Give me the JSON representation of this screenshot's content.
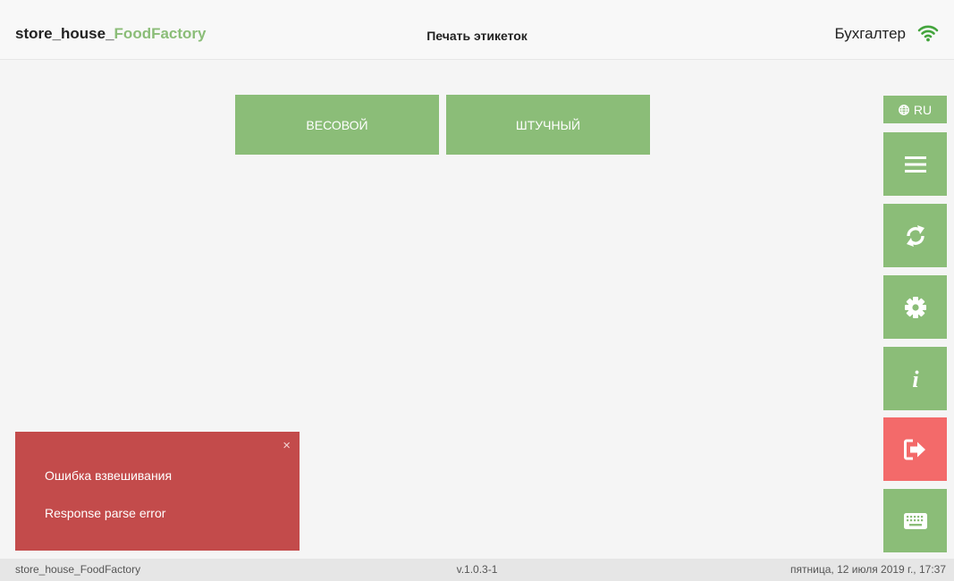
{
  "header": {
    "brand_prefix": "store_house_",
    "brand_accent": "FoodFactory",
    "title": "Печать этикеток",
    "user": "Бухгалтер",
    "connection_icon": "wifi-icon"
  },
  "modes": {
    "weight_label": "ВЕСОВОЙ",
    "piece_label": "ШТУЧНЫЙ"
  },
  "side_panel": {
    "language_label": "RU",
    "language_icon": "globe-icon",
    "buttons": [
      {
        "icon": "menu-icon"
      },
      {
        "icon": "sync-icon"
      },
      {
        "icon": "gear-icon"
      },
      {
        "icon": "info-icon"
      },
      {
        "icon": "sign-out-icon"
      },
      {
        "icon": "keyboard-icon"
      }
    ]
  },
  "toast": {
    "title": "Ошибка взвешивания",
    "message": "Response parse error",
    "close_label": "×"
  },
  "footer": {
    "app_name": "store_house_FoodFactory",
    "version": "v.1.0.3-1",
    "datetime": "пятница, 12 июля 2019 г., 17:37"
  },
  "colors": {
    "accent_green": "#8bbd78",
    "danger_red": "#f36a6a",
    "toast_red": "#c34b4b",
    "background": "#f5f5f5"
  }
}
